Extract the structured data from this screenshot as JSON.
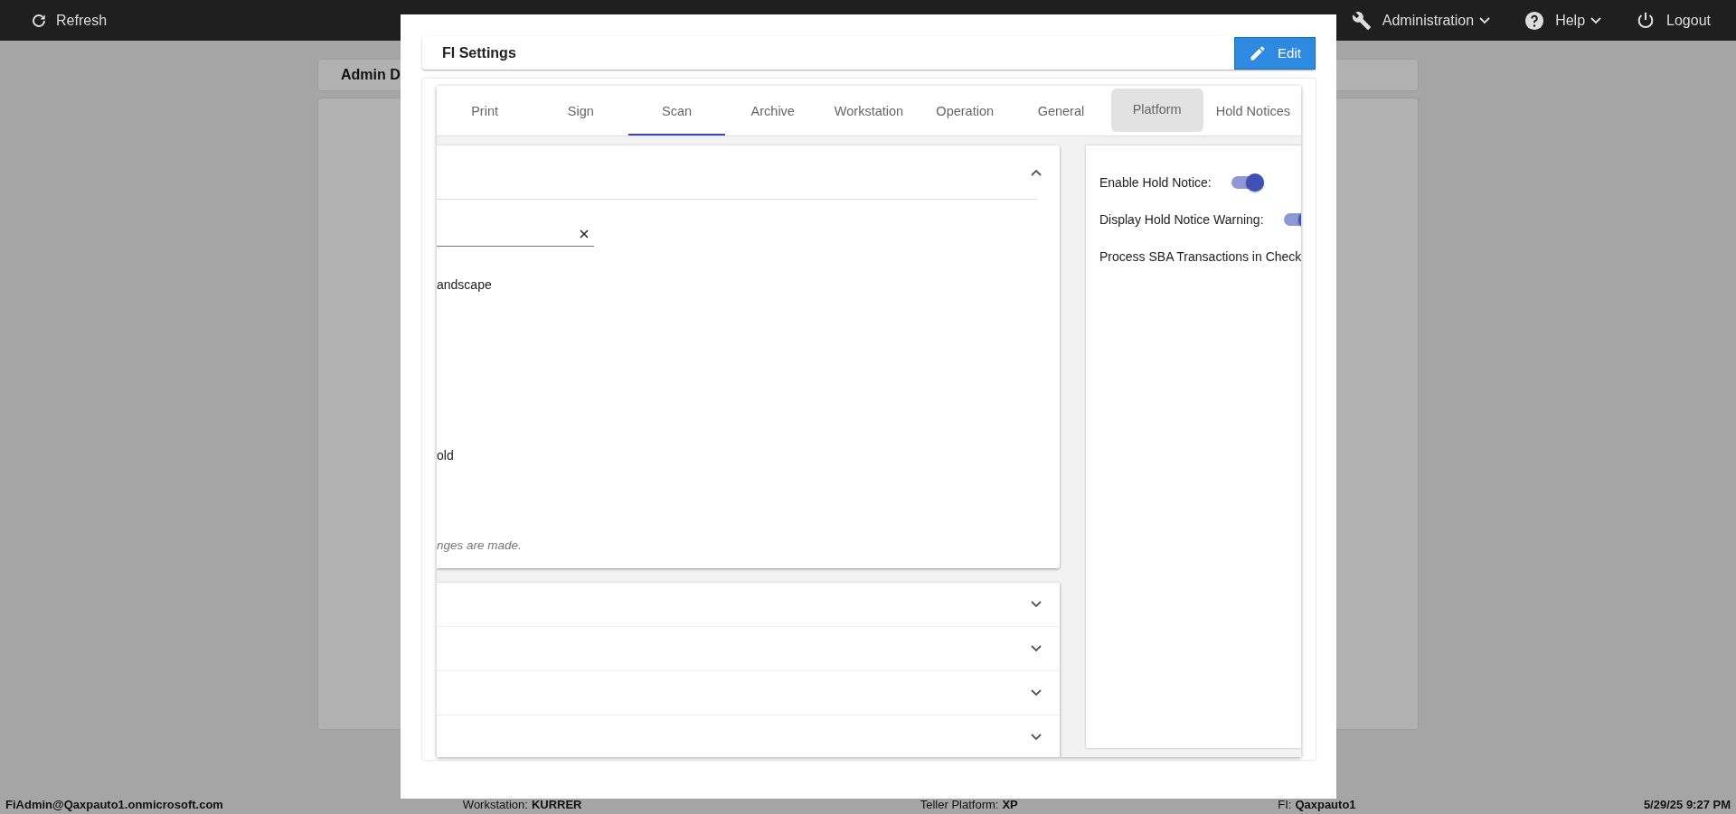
{
  "top_bar": {
    "refresh": "Refresh",
    "menus": [
      {
        "label": "Administration",
        "kind": "tools",
        "dropdown": true
      },
      {
        "label": "Help",
        "kind": "help",
        "dropdown": true
      },
      {
        "label": "Logout",
        "kind": "power",
        "dropdown": false
      }
    ]
  },
  "background": {
    "card_title": "Admin D"
  },
  "dialog": {
    "title": "FI Settings",
    "edit_button": "Edit",
    "tabs": [
      {
        "label": "Print",
        "selected": false,
        "highlighted": false
      },
      {
        "label": "Sign",
        "selected": false,
        "highlighted": false
      },
      {
        "label": "Scan",
        "selected": true,
        "highlighted": false
      },
      {
        "label": "Archive",
        "selected": false,
        "highlighted": false
      },
      {
        "label": "Workstation",
        "selected": false,
        "highlighted": false
      },
      {
        "label": "Operation",
        "selected": false,
        "highlighted": false
      },
      {
        "label": "General",
        "selected": false,
        "highlighted": false
      },
      {
        "label": "Platform",
        "selected": false,
        "highlighted": true
      },
      {
        "label": "Hold Notices",
        "selected": false,
        "highlighted": false
      }
    ],
    "left_panel": {
      "expanded": true,
      "lines": [
        "andscape",
        "old"
      ],
      "note": "nges are made."
    },
    "accordion": [
      {
        "expanded": false
      },
      {
        "expanded": false
      },
      {
        "expanded": false
      },
      {
        "expanded": false
      }
    ],
    "right_panel": [
      {
        "label": "Enable Hold Notice:",
        "kind": "toggle",
        "on": true
      },
      {
        "label": "Display Hold Notice Warning:",
        "kind": "toggle",
        "on": true
      },
      {
        "label": "Process SBA Transactions in Check",
        "kind": "label"
      }
    ]
  },
  "status_bar": {
    "user": "FiAdmin@Qaxpauto1.onmicrosoft.com",
    "fields": [
      {
        "label": "Workstation:",
        "value": "KURRER"
      },
      {
        "label": "Teller Platform:",
        "value": "XP"
      },
      {
        "label": "FI:",
        "value": "Qaxpauto1"
      }
    ],
    "datetime": "5/29/25 9:27 PM"
  }
}
